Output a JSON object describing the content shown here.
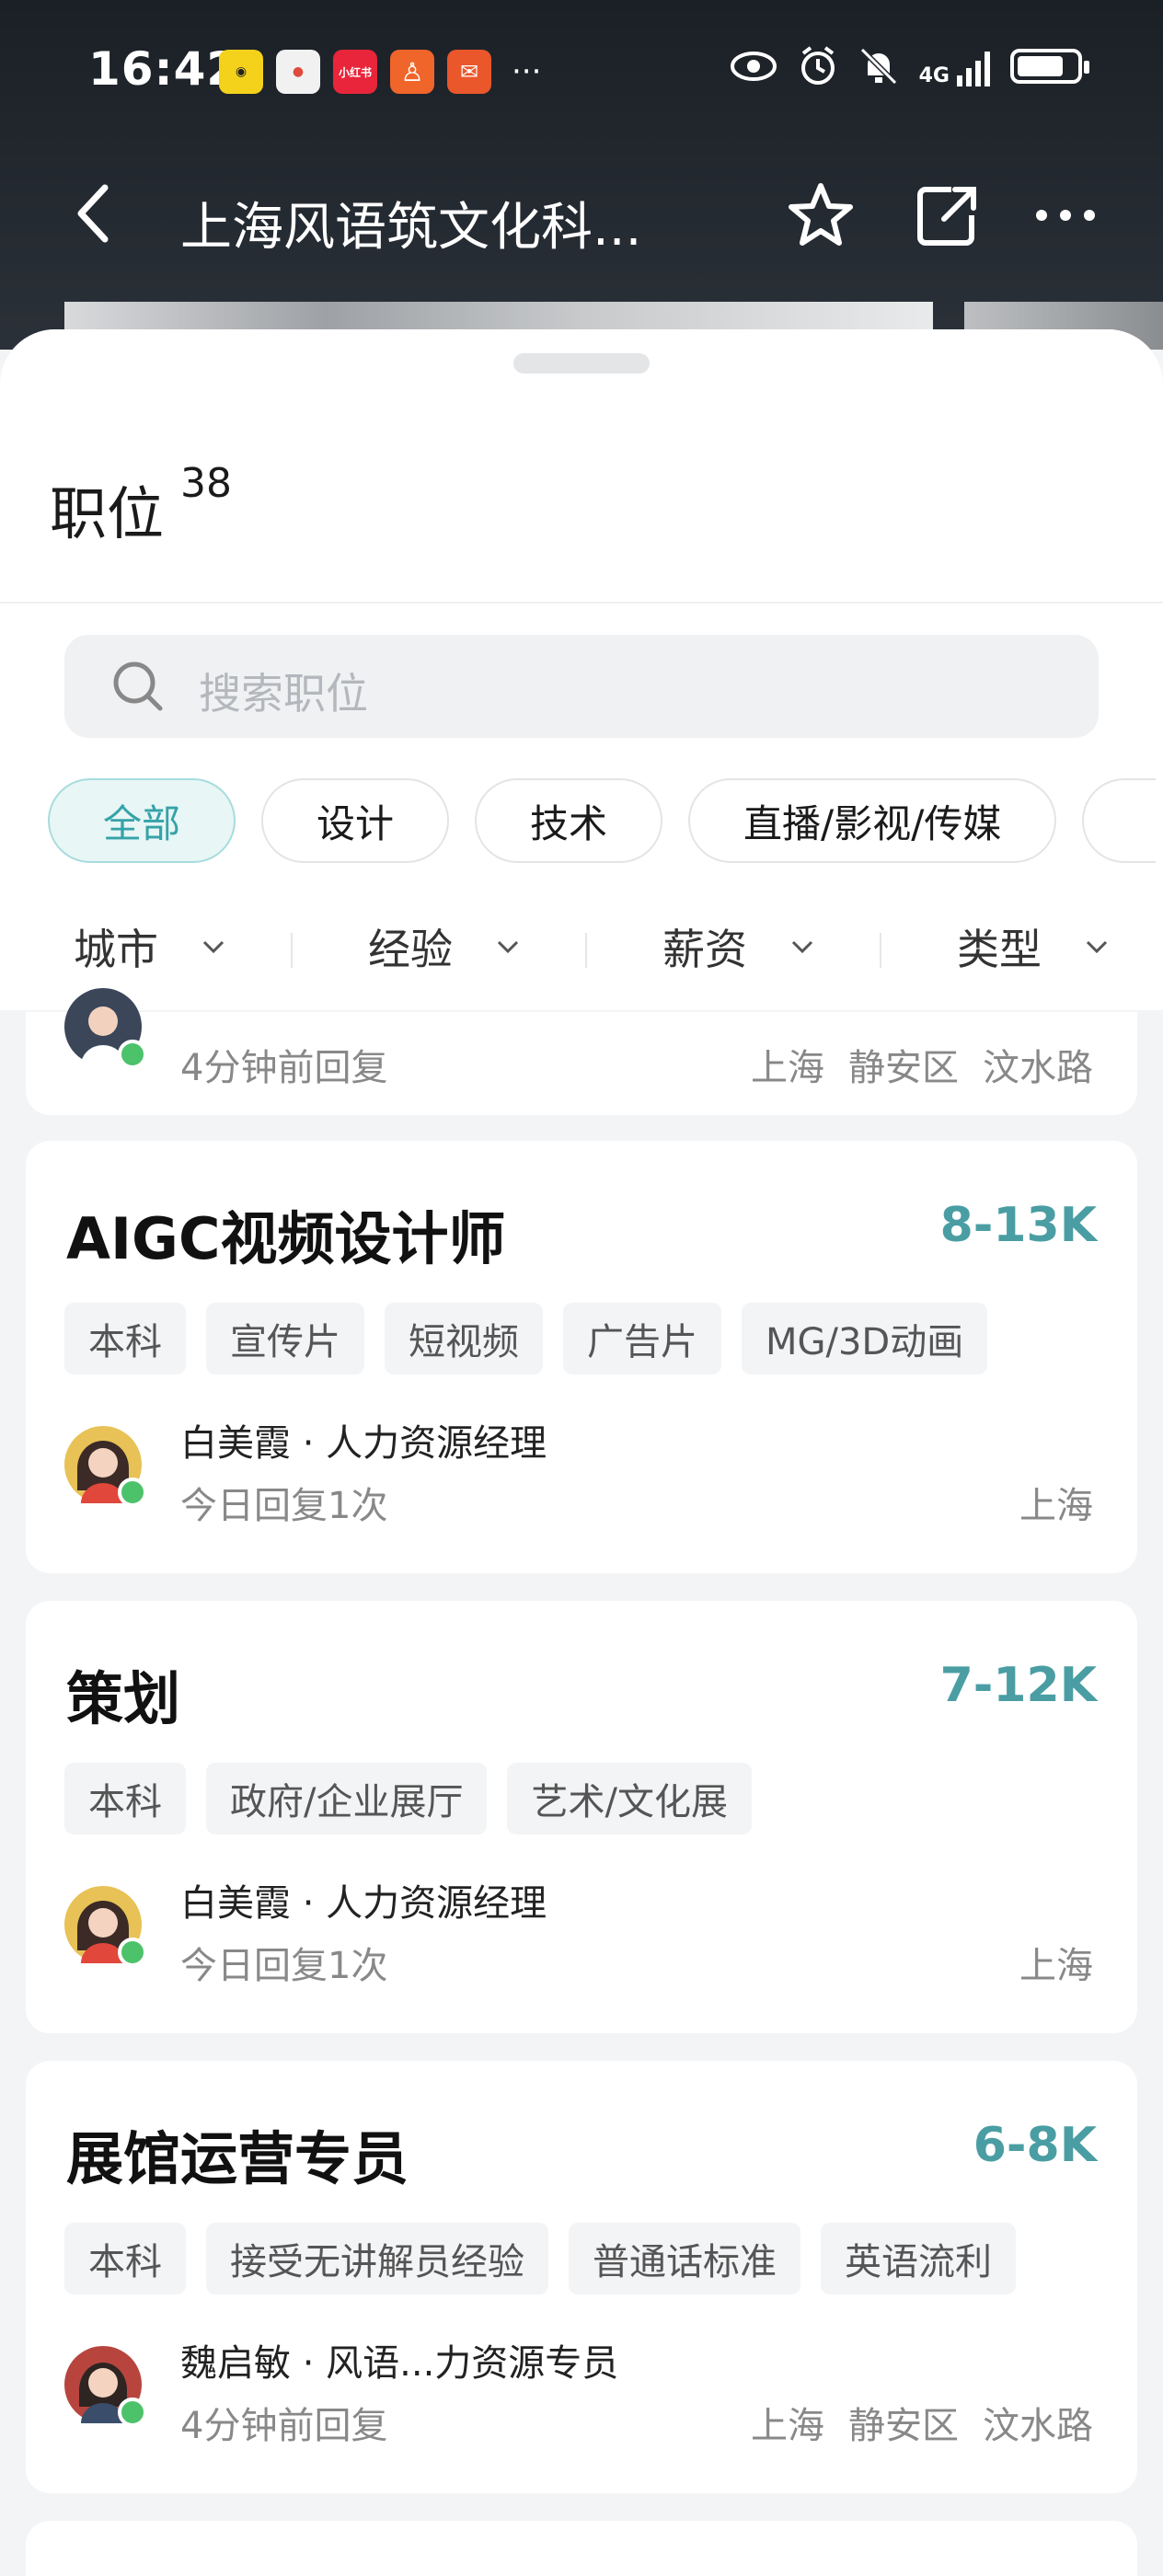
{
  "status_bar": {
    "time": "16:42",
    "network": "4G",
    "notification_apps": [
      "app-1",
      "app-2",
      "xiaohongshu",
      "app-4",
      "app-5"
    ],
    "xiaohongshu_label": "小红书",
    "more": "···"
  },
  "nav": {
    "title": "上海风语筑文化科..."
  },
  "sheet": {
    "title": "职位",
    "count": "38"
  },
  "search": {
    "placeholder": "搜索职位"
  },
  "categories": [
    {
      "label": "全部",
      "active": true
    },
    {
      "label": "设计",
      "active": false
    },
    {
      "label": "技术",
      "active": false
    },
    {
      "label": "直播/影视/传媒",
      "active": false
    }
  ],
  "filters": [
    {
      "label": "城市"
    },
    {
      "label": "经验"
    },
    {
      "label": "薪资"
    },
    {
      "label": "类型"
    }
  ],
  "partial_card": {
    "reply": "4分钟前回复",
    "location": [
      "上海",
      "静安区",
      "汶水路"
    ]
  },
  "jobs": [
    {
      "title": "AIGC视频设计师",
      "salary": "8-13K",
      "tags": [
        "本科",
        "宣传片",
        "短视频",
        "广告片",
        "MG/3D动画"
      ],
      "recruiter": "白美霞 · 人力资源经理",
      "reply": "今日回复1次",
      "location": [
        "上海"
      ]
    },
    {
      "title": "策划",
      "salary": "7-12K",
      "tags": [
        "本科",
        "政府/企业展厅",
        "艺术/文化展"
      ],
      "recruiter": "白美霞 · 人力资源经理",
      "reply": "今日回复1次",
      "location": [
        "上海"
      ]
    },
    {
      "title": "展馆运营专员",
      "salary": "6-8K",
      "tags": [
        "本科",
        "接受无讲解员经验",
        "普通话标准",
        "英语流利"
      ],
      "recruiter": "魏启敏 · 风语...力资源专员",
      "reply": "4分钟前回复",
      "location": [
        "上海",
        "静安区",
        "汶水路"
      ]
    }
  ],
  "colors": {
    "accent": "#4a9ea3",
    "chip_active_bg": "#e8f6f6",
    "online": "#4cc26b"
  }
}
